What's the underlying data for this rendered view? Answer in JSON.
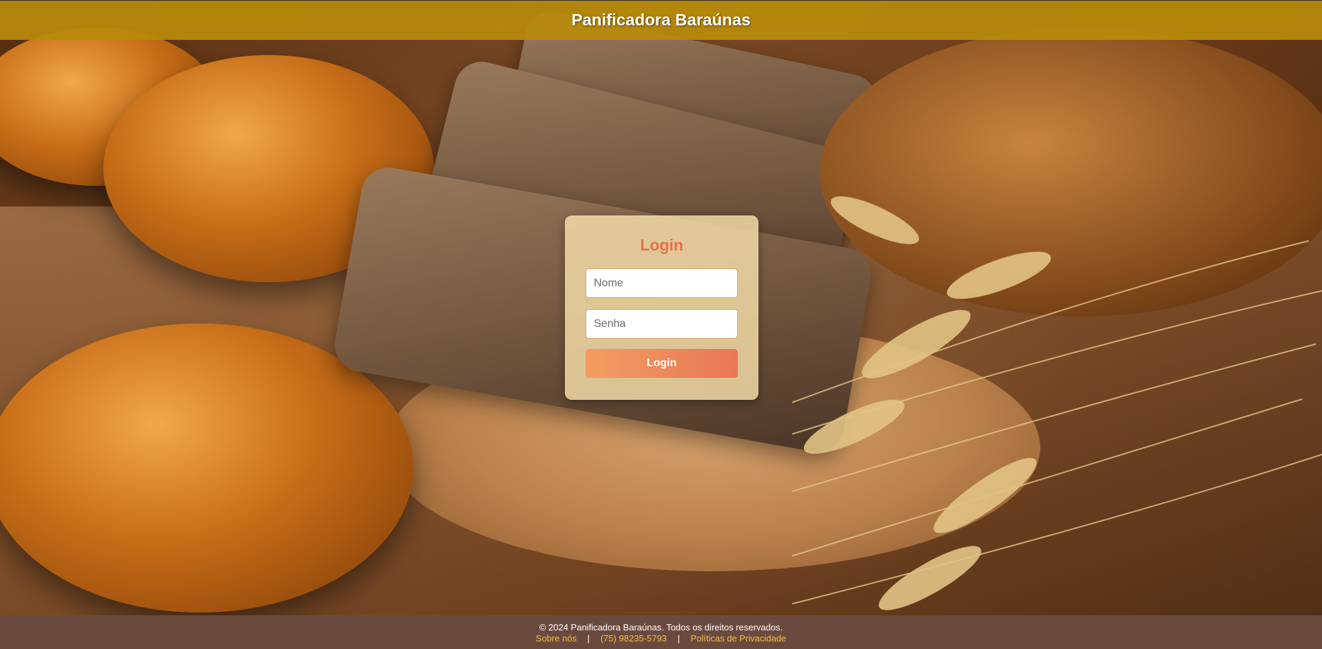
{
  "header": {
    "title": "Panificadora Baraúnas"
  },
  "login": {
    "title": "Login",
    "name_placeholder": "Nome",
    "password_placeholder": "Senha",
    "button_label": "Login"
  },
  "footer": {
    "copyright": "© 2024 Panificadora Baraúnas. Todos os direitos reservados.",
    "links": {
      "about": "Sobre nós",
      "phone": "(75) 98235-5793",
      "privacy": "Políticas de Privacidade"
    },
    "separator": "|"
  },
  "colors": {
    "header_bg": "#b88a0a",
    "footer_bg": "#6b4a3e",
    "accent": "#e8704a",
    "link": "#f0c040"
  }
}
